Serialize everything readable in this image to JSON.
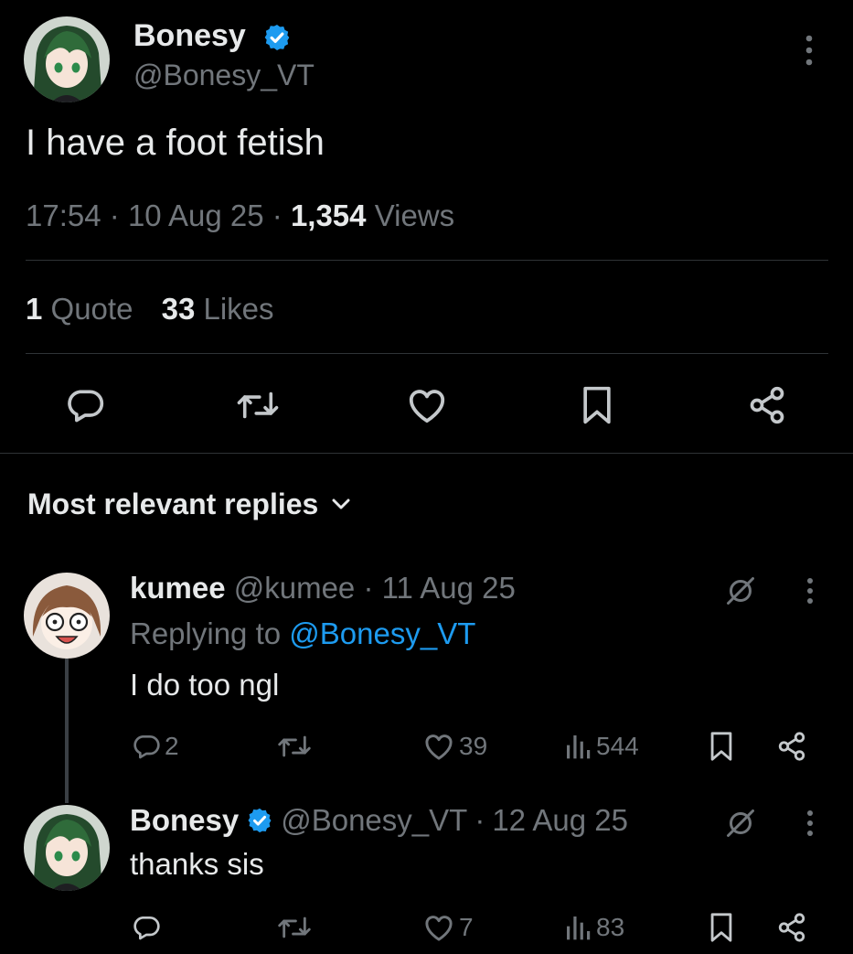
{
  "main_tweet": {
    "display_name": "Bonesy",
    "handle": "@Bonesy_VT",
    "text": "I have a foot fetish",
    "time": "17:54",
    "date": "10 Aug 25",
    "views_count": "1,354",
    "views_label": "Views",
    "quotes_count": "1",
    "quotes_label": "Quote",
    "likes_count": "33",
    "likes_label": "Likes"
  },
  "replies_header": {
    "label": "Most relevant replies"
  },
  "replies": [
    {
      "display_name": "kumee",
      "handle": "@kumee",
      "date": "11 Aug 25",
      "replying_prefix": "Replying to",
      "replying_to": "@Bonesy_VT",
      "text": "I do too ngl",
      "reply_count": "2",
      "like_count": "39",
      "view_count": "544"
    },
    {
      "display_name": "Bonesy",
      "handle": "@Bonesy_VT",
      "date": "12 Aug 25",
      "text": "thanks sis",
      "like_count": "7",
      "view_count": "83"
    }
  ],
  "colors": {
    "background": "#000000",
    "text": "#e7e9ea",
    "muted": "#71767b",
    "accent": "#1d9bf0",
    "divider": "#2f3336"
  },
  "icons": [
    "verified-badge-icon",
    "more-icon",
    "reply-icon",
    "retweet-icon",
    "like-icon",
    "bookmark-icon",
    "share-icon",
    "views-icon",
    "grok-icon",
    "chevron-down-icon"
  ]
}
